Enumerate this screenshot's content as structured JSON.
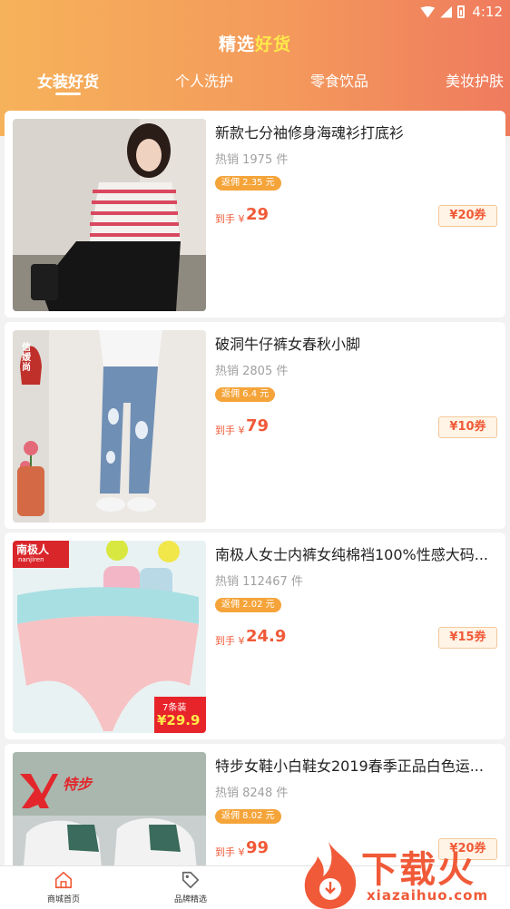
{
  "status_bar": {
    "time": "4:12"
  },
  "header": {
    "title_main": "精选",
    "title_highlight": "好货"
  },
  "tabs": [
    {
      "label": "女装好货"
    },
    {
      "label": "个人洗护"
    },
    {
      "label": "零食饮品"
    },
    {
      "label": "美妆护肤"
    }
  ],
  "products": [
    {
      "name": "新款七分袖修身海魂衫打底衫",
      "sold": "热销 1975 件",
      "commission": "返佣 2.35 元",
      "price_label": "到手 ¥",
      "price": "29",
      "coupon": "¥20券"
    },
    {
      "name": "破洞牛仔裤女春秋小脚",
      "sold": "热销 2805 件",
      "commission": "返佣 6.4 元",
      "price_label": "到手 ¥",
      "price": "79",
      "coupon": "¥10券",
      "image_badge": "信嫒尚"
    },
    {
      "name": "南极人女士内裤女纯棉裆100%性感大码...",
      "sold": "热销 112467 件",
      "commission": "返佣 2.02 元",
      "price_label": "到手 ¥",
      "price": "24.9",
      "coupon": "¥15券",
      "image_brand": "南极人",
      "image_brand_sub": "nanjiren",
      "image_pack": "7条装",
      "image_price": "¥29.9"
    },
    {
      "name": "特步女鞋小白鞋女2019春季正品白色运...",
      "sold": "热销 8248 件",
      "commission": "返佣 8.02 元",
      "price_label": "到手 ¥",
      "price": "99",
      "coupon": "¥20券",
      "image_brand": "特步"
    }
  ],
  "tabbar": [
    {
      "label": "商城首页",
      "icon": "home-icon"
    },
    {
      "label": "品牌精选",
      "icon": "tag-icon"
    }
  ],
  "watermark": {
    "text": "下载火",
    "url": "xiazaihuo.com"
  }
}
